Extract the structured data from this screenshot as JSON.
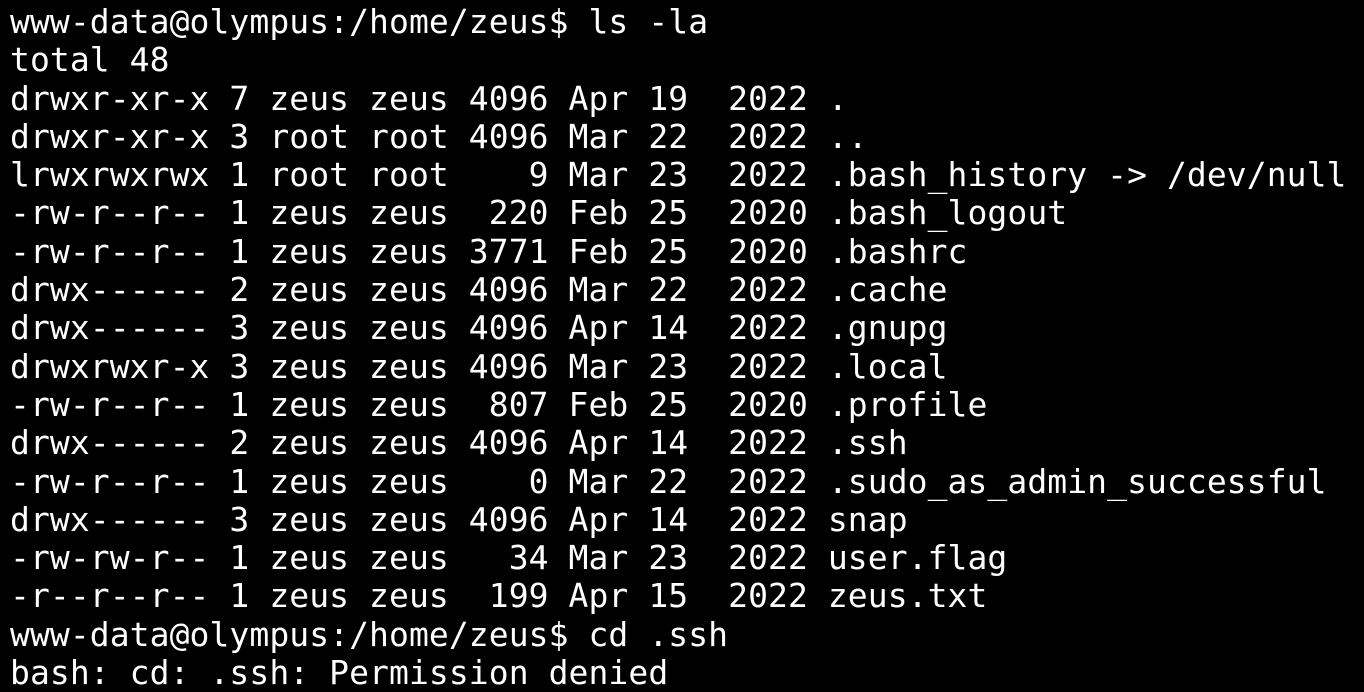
{
  "terminal": {
    "background_color": "#000000",
    "text_color": "#ffffff",
    "prompt": "www-data@olympus:/home/zeus$",
    "lines": [
      "www-data@olympus:/home/zeus$ ls -la",
      "total 48",
      "drwxr-xr-x 7 zeus zeus 4096 Apr 19  2022 .",
      "drwxr-xr-x 3 root root 4096 Mar 22  2022 ..",
      "lrwxrwxrwx 1 root root    9 Mar 23  2022 .bash_history -> /dev/null",
      "-rw-r--r-- 1 zeus zeus  220 Feb 25  2020 .bash_logout",
      "-rw-r--r-- 1 zeus zeus 3771 Feb 25  2020 .bashrc",
      "drwx------ 2 zeus zeus 4096 Mar 22  2022 .cache",
      "drwx------ 3 zeus zeus 4096 Apr 14  2022 .gnupg",
      "drwxrwxr-x 3 zeus zeus 4096 Mar 23  2022 .local",
      "-rw-r--r-- 1 zeus zeus  807 Feb 25  2020 .profile",
      "drwx------ 2 zeus zeus 4096 Apr 14  2022 .ssh",
      "-rw-r--r-- 1 zeus zeus    0 Mar 22  2022 .sudo_as_admin_successful",
      "drwx------ 3 zeus zeus 4096 Apr 14  2022 snap",
      "-rw-rw-r-- 1 zeus zeus   34 Mar 23  2022 user.flag",
      "-r--r--r-- 1 zeus zeus  199 Apr 15  2022 zeus.txt",
      "www-data@olympus:/home/zeus$ cd .ssh",
      "bash: cd: .ssh: Permission denied"
    ]
  }
}
